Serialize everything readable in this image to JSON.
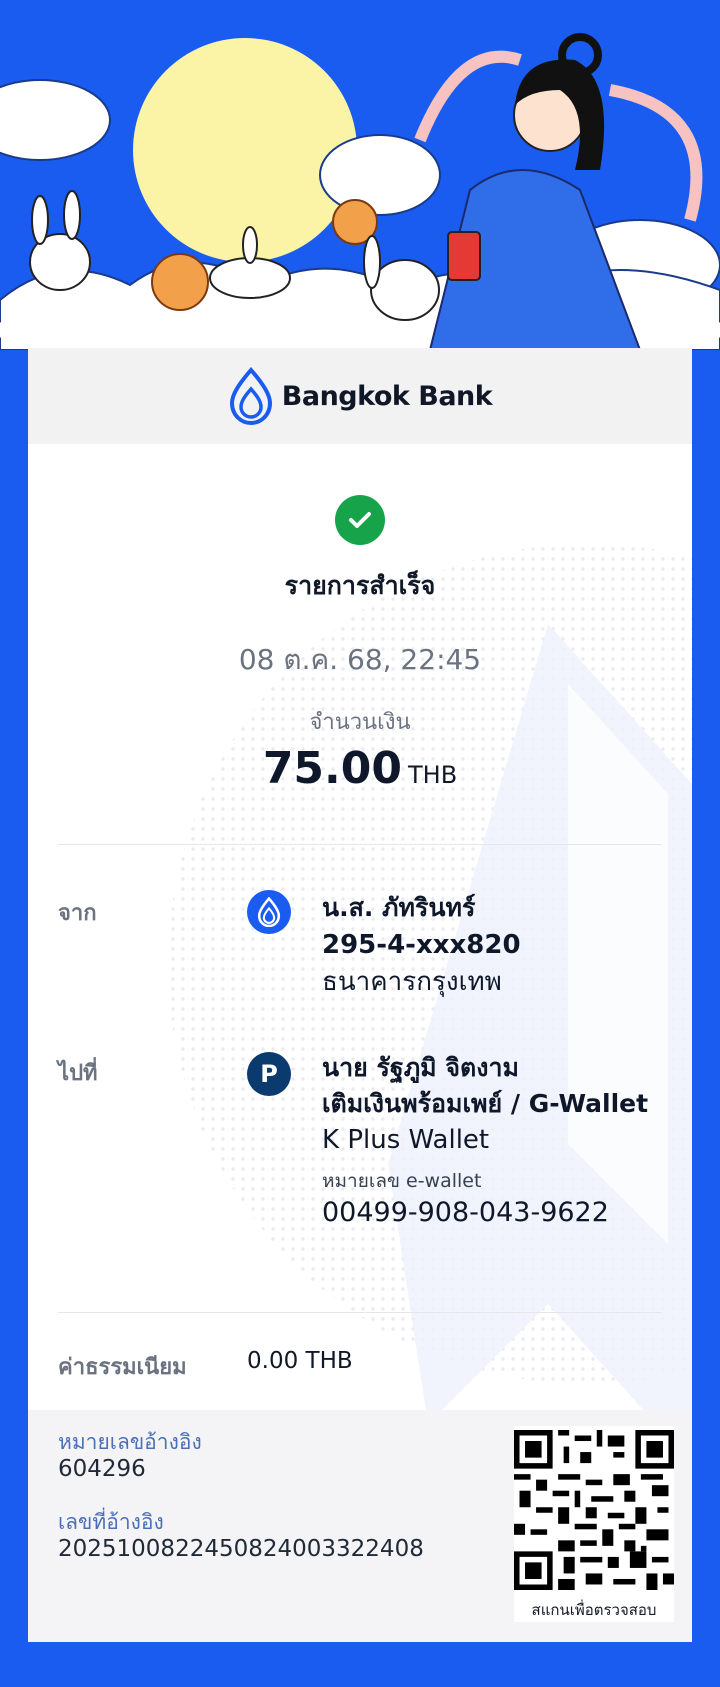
{
  "bank": {
    "name": "Bangkok Bank"
  },
  "status": {
    "title": "รายการสำเร็จ"
  },
  "transaction": {
    "datetime": "08 ต.ค. 68, 22:45",
    "amount_label": "จำนวนเงิน",
    "amount": "75.00",
    "currency": "THB"
  },
  "from": {
    "label": "จาก",
    "name": "น.ส. ภัทรินทร์",
    "account": "295-4-xxx820",
    "bank": "ธนาคารกรุงเทพ"
  },
  "to": {
    "label": "ไปที่",
    "avatar_letter": "P",
    "name": "นาย รัฐภูมิ จิตงาม",
    "service": "เติมเงินพร้อมเพย์ / G-Wallet",
    "wallet": "K Plus Wallet",
    "ewallet_label": "หมายเลข e-wallet",
    "ewallet_number": "00499-908-043-9622"
  },
  "fee": {
    "label": "ค่าธรรมเนียม",
    "value": "0.00 THB"
  },
  "reference": {
    "ref_label": "หมายเลขอ้างอิง",
    "ref_value": "604296",
    "ref_no_label": "เลขที่อ้างอิง",
    "ref_no_value": "20251008224508240033224​08",
    "qr_caption": "สแกนเพื่อตรวจสอบ"
  },
  "colors": {
    "background": "#1a5cf0",
    "success": "#16a34a",
    "promptpay": "#0b3a6e"
  }
}
